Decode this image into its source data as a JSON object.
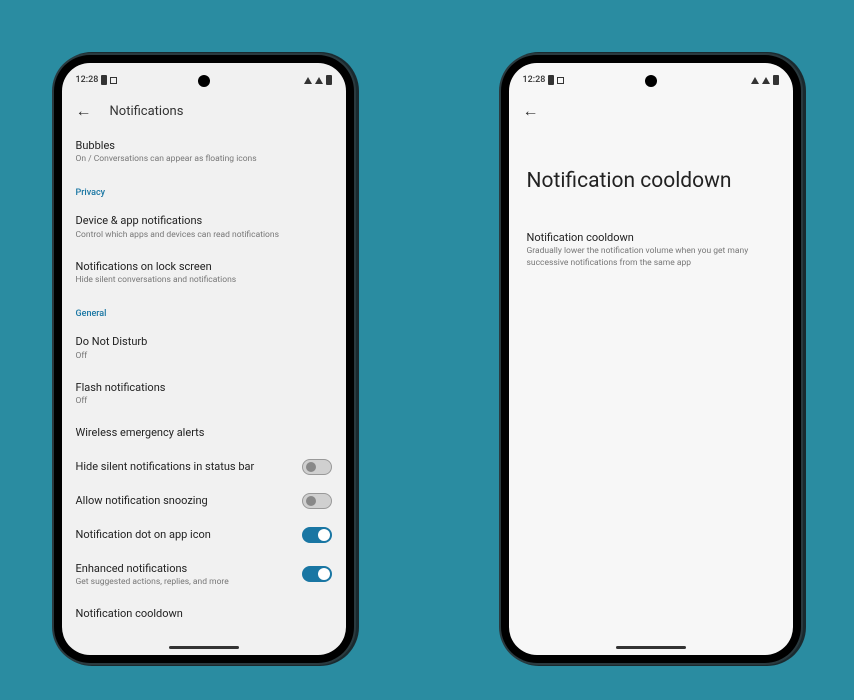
{
  "status": {
    "time": "12:28"
  },
  "phone1": {
    "title": "Notifications",
    "items": {
      "bubbles": {
        "title": "Bubbles",
        "sub": "On / Conversations can appear as floating icons"
      },
      "privacy_header": "Privacy",
      "device_app": {
        "title": "Device & app notifications",
        "sub": "Control which apps and devices can read notifications"
      },
      "lock": {
        "title": "Notifications on lock screen",
        "sub": "Hide silent conversations and notifications"
      },
      "general_header": "General",
      "dnd": {
        "title": "Do Not Disturb",
        "sub": "Off"
      },
      "flash": {
        "title": "Flash notifications",
        "sub": "Off"
      },
      "wireless": {
        "title": "Wireless emergency alerts"
      },
      "hide_silent": {
        "title": "Hide silent notifications in status bar"
      },
      "snoozing": {
        "title": "Allow notification snoozing"
      },
      "dot": {
        "title": "Notification dot on app icon"
      },
      "enhanced": {
        "title": "Enhanced notifications",
        "sub": "Get suggested actions, replies, and more"
      },
      "cooldown": {
        "title": "Notification cooldown"
      }
    }
  },
  "phone2": {
    "large_title": "Notification cooldown",
    "item": {
      "title": "Notification cooldown",
      "sub": "Gradually lower the notification volume when you get many successive notifications from the same app"
    }
  }
}
